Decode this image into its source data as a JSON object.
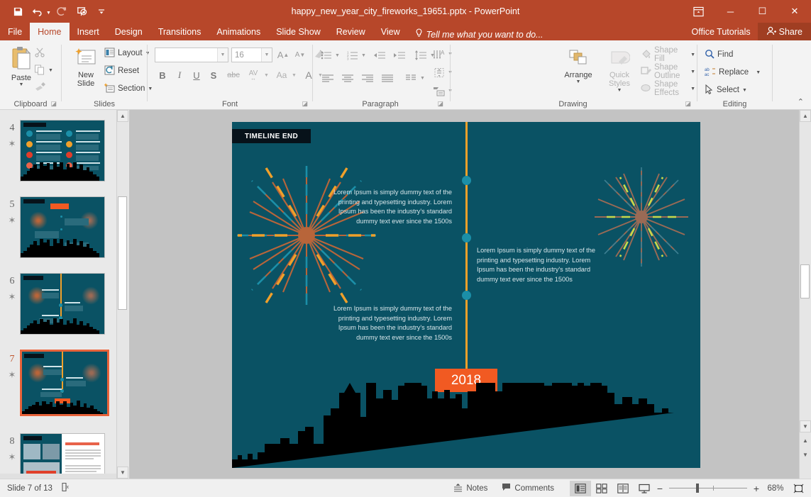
{
  "window": {
    "title": "happy_new_year_city_fireworks_19651.pptx - PowerPoint",
    "quick_access": [
      {
        "name": "save",
        "glyph": "save-icon"
      },
      {
        "name": "undo",
        "glyph": "undo-icon"
      },
      {
        "name": "redo",
        "glyph": "redo-icon"
      },
      {
        "name": "start-from-beginning",
        "glyph": "present-icon"
      },
      {
        "name": "customize-qat",
        "glyph": "chevron-down-icon"
      }
    ],
    "controls": {
      "ribbon_display": "⬒",
      "minimize": "─",
      "maximize": "☐",
      "close": "✕"
    }
  },
  "tabs": [
    {
      "label": "File",
      "active": false
    },
    {
      "label": "Home",
      "active": true
    },
    {
      "label": "Insert",
      "active": false
    },
    {
      "label": "Design",
      "active": false
    },
    {
      "label": "Transitions",
      "active": false
    },
    {
      "label": "Animations",
      "active": false
    },
    {
      "label": "Slide Show",
      "active": false
    },
    {
      "label": "Review",
      "active": false
    },
    {
      "label": "View",
      "active": false
    }
  ],
  "tellme": {
    "placeholder": "Tell me what you want to do..."
  },
  "account": {
    "tutorials": "Office Tutorials",
    "share": "Share"
  },
  "ribbon": {
    "groups": [
      {
        "name": "clipboard",
        "label": "Clipboard"
      },
      {
        "name": "slides",
        "label": "Slides"
      },
      {
        "name": "font",
        "label": "Font"
      },
      {
        "name": "paragraph",
        "label": "Paragraph"
      },
      {
        "name": "drawing",
        "label": "Drawing"
      },
      {
        "name": "editing",
        "label": "Editing"
      }
    ],
    "clipboard": {
      "paste": "Paste",
      "cut": "cut-icon",
      "copy": "copy-icon",
      "format_painter": "format-painter-icon"
    },
    "slides": {
      "new_slide": "New\nSlide",
      "new_slide_line1": "New",
      "new_slide_line2": "Slide",
      "layout": "Layout",
      "reset": "Reset",
      "section": "Section"
    },
    "font": {
      "font_name": "",
      "font_size": "16",
      "increase_size": "A",
      "decrease_size": "A",
      "clear_formatting": "clear-formatting-icon",
      "bold": "B",
      "italic": "I",
      "underline": "U",
      "shadow": "S",
      "strikethrough": "abc",
      "character_spacing": "AV",
      "change_case": "Aa",
      "font_color": "A"
    },
    "paragraph": {
      "bullets": "bullets-icon",
      "numbering": "numbering-icon",
      "decrease_indent": "decrease-indent-icon",
      "increase_indent": "increase-indent-icon",
      "line_spacing": "line-spacing-icon",
      "text_direction": "text-direction-icon",
      "align_text": "align-text-icon",
      "convert_smartart": "smartart-icon",
      "align_left": "align-left-icon",
      "center": "center-icon",
      "align_right": "align-right-icon",
      "justify": "justify-icon",
      "columns": "columns-icon"
    },
    "drawing": {
      "shapes": [
        "textbox",
        "line",
        "arrow",
        "rectangle",
        "oval",
        "rounded-rect",
        "triangle",
        "elbow-connector",
        "elbow-arrow",
        "block-arrow-right",
        "block-arrow-down",
        "flowchart-shape",
        "scribble",
        "arc",
        "curve",
        "left-brace",
        "right-brace",
        "star"
      ],
      "arrange": "Arrange",
      "quick_styles_line1": "Quick",
      "quick_styles_line2": "Styles",
      "shape_fill": "Shape Fill",
      "shape_outline": "Shape Outline",
      "shape_effects": "Shape Effects"
    },
    "editing": {
      "find": "Find",
      "replace": "Replace",
      "select": "Select"
    },
    "collapse_ribbon": "collapse-ribbon-icon"
  },
  "thumbnails": [
    {
      "number": "4",
      "selected": false,
      "animated": true
    },
    {
      "number": "5",
      "selected": false,
      "animated": true
    },
    {
      "number": "6",
      "selected": false,
      "animated": true
    },
    {
      "number": "7",
      "selected": true,
      "animated": true
    },
    {
      "number": "8",
      "selected": false,
      "animated": true
    }
  ],
  "slide": {
    "label": "TIMELINE END",
    "year": "2018",
    "body_text": "Lorem Ipsum is simply dummy text of the printing and typesetting industry. Lorem Ipsum has been the industry's standard dummy text ever since the 1500s",
    "blocks": [
      {
        "id": "top-left",
        "align": "right",
        "text": "Lorem Ipsum is simply dummy text of the printing and typesetting industry. Lorem Ipsum has been the industry's standard dummy text ever since the 1500s"
      },
      {
        "id": "middle-right",
        "align": "left",
        "text": "Lorem Ipsum is simply dummy text of the printing and typesetting industry. Lorem Ipsum has been the industry's standard dummy text ever since the 1500s"
      },
      {
        "id": "bottom-left",
        "align": "right",
        "text": "Lorem Ipsum is simply dummy text of the printing and typesetting industry. Lorem Ipsum has been the industry's standard dummy text ever since the 1500s"
      }
    ],
    "colors": {
      "background": "#0a5264",
      "timeline_line": "#f0a02a",
      "node": "#1b8fa8",
      "badge": "#f15a22",
      "label_bar": "#07121a",
      "skyline": "#000000",
      "firework_left_rays": "#b8653a",
      "firework_left_accent_orange": "#f0a02a",
      "firework_left_accent_teal": "#1b8fa8",
      "firework_right_rays": "#9a6a55",
      "firework_right_accent": "#c8d94a",
      "text": "#d8e6ea"
    }
  },
  "statusbar": {
    "slide_counter": "Slide 7 of 13",
    "language_icon": "spell-check-icon",
    "notes": "Notes",
    "comments": "Comments",
    "views": [
      {
        "name": "normal-view",
        "glyph": "normal-view-icon",
        "active": true
      },
      {
        "name": "slide-sorter-view",
        "glyph": "slide-sorter-icon",
        "active": false
      },
      {
        "name": "reading-view",
        "glyph": "reading-view-icon",
        "active": false
      },
      {
        "name": "slide-show-view",
        "glyph": "slide-show-icon",
        "active": false
      }
    ],
    "zoom_out": "−",
    "zoom_in": "+",
    "zoom_level": "68%",
    "fit_to_window": "fit-slide-icon"
  }
}
